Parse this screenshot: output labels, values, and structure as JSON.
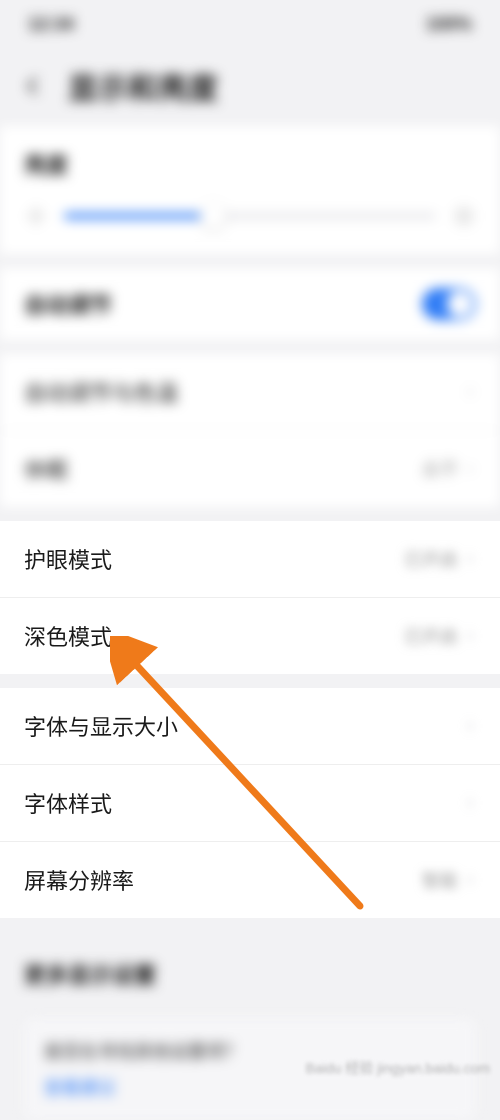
{
  "status": {
    "time_left": "12:34",
    "right": "100%"
  },
  "header": {
    "title": "显示和亮度"
  },
  "brightness": {
    "label": "亮度"
  },
  "auto_adjust": {
    "label": "自动调节"
  },
  "group_a": {
    "item1": {
      "label": "自动调节与色温",
      "value": " "
    },
    "item2": {
      "label": "休眠",
      "value": "永不"
    }
  },
  "group_b": {
    "item1": {
      "label": "护眼模式",
      "value": "已开启"
    },
    "item2": {
      "label": "深色模式",
      "value": "已开启"
    }
  },
  "group_c": {
    "item1": {
      "label": "字体与显示大小",
      "value": " "
    },
    "item2": {
      "label": "字体样式",
      "value": " "
    },
    "item3": {
      "label": "屏幕分辨率",
      "value": "智能"
    }
  },
  "more": {
    "label": "更多显示设置"
  },
  "card": {
    "question": "是否在寻找其他设置项？",
    "link": "查看建议"
  },
  "watermark": "Baidu 经验 jingyan.baidu.com"
}
